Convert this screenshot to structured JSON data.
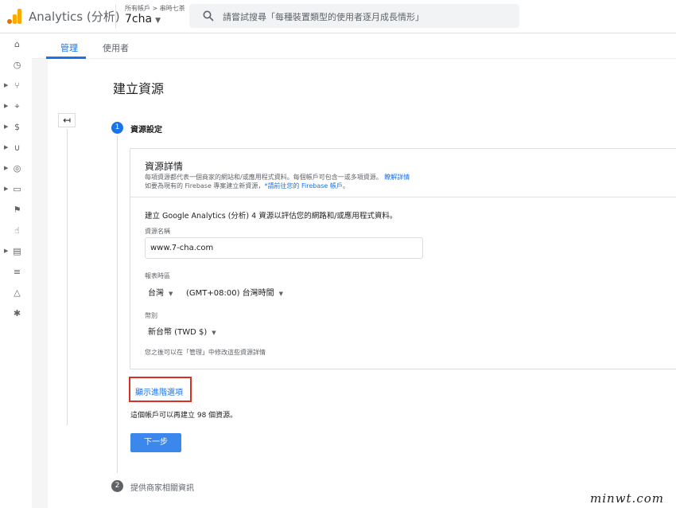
{
  "header": {
    "app_title": "Analytics (分析)",
    "breadcrumb": "所有帳戶 > 串時七茶",
    "account_name": "7cha",
    "search_placeholder": "請嘗試搜尋「每種裝置類型的使用者逐月成長情形」"
  },
  "rail": {
    "icons": [
      "home-icon",
      "clock-icon",
      "flow-icon",
      "tag-icon",
      "dollar-icon",
      "magnet-icon",
      "globe-icon",
      "devices-icon",
      "flag-icon",
      "touch-icon",
      "report-icon",
      "list-icon",
      "shapes-icon",
      "bug-icon"
    ]
  },
  "tabs": {
    "admin": "管理",
    "user": "使用者"
  },
  "page": {
    "title": "建立資源",
    "back_glyph": "↤",
    "step1_number": "1",
    "step1_label": "資源設定",
    "step2_number": "2",
    "step2_label": "提供商家相關資訊"
  },
  "card": {
    "title": "資源詳情",
    "desc_line1": "每項資源都代表一個商家的網站和/或應用程式資料。每個帳戶可包含一或多項資源。",
    "desc_line1_link": "瞭解詳情",
    "desc_line2": "如要為現有的 Firebase 專案建立新資源，",
    "desc_line2_link": "*請前往您的 Firebase 帳戶",
    "desc_line2_end": "。",
    "lead": "建立 Google Analytics (分析) 4 資源以評估您的網路和/或應用程式資料。",
    "name_label": "資源名稱",
    "name_value": "www.7-cha.com",
    "timezone_label": "報表時區",
    "country_value": "台灣",
    "timezone_value": "(GMT+08:00) 台灣時間",
    "currency_label": "幣別",
    "currency_value": "新台幣 (TWD $)",
    "note": "您之後可以在「管理」中修改這些資源詳情"
  },
  "advanced_link": "顯示進階選項",
  "remaining_text": "這個帳戶可以再建立 98 個資源。",
  "next_button": "下一步",
  "watermark": "minwt.com",
  "colors": {
    "accent": "#1a73e8",
    "highlight_box": "#d93025",
    "logo_orange": "#f9ab00"
  }
}
